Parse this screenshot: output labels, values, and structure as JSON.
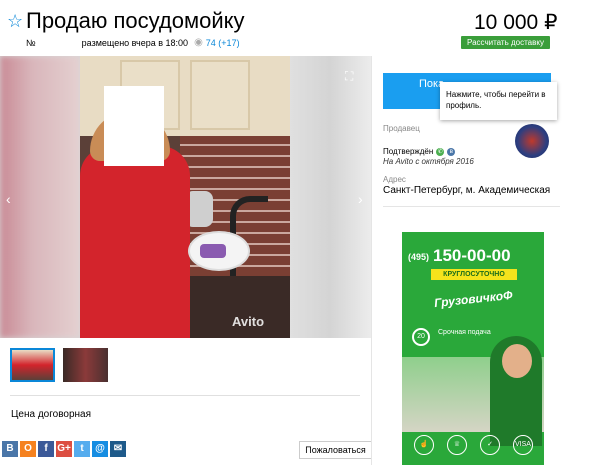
{
  "listing": {
    "title": "Продаю посудомойку",
    "price": "10 000 ₽",
    "number_label": "№",
    "posted": "размещено вчера в 18:00",
    "views": "74 (+17)",
    "delivery_btn": "Рассчитать доставку",
    "negotiable": "Цена договорная"
  },
  "gallery": {
    "watermark": "Avito",
    "prev": "‹",
    "next": "›"
  },
  "seller": {
    "show_btn": "Пока...",
    "tooltip": "Нажмите, чтобы перейти в профиль.",
    "label": "Продавец",
    "confirmed": "Подтверждён",
    "since": "На Avito с октября 2016",
    "address_label": "Адрес",
    "address": "Санкт-Петербург, м. Академическая"
  },
  "share": {
    "buttons": [
      "В",
      "О",
      "f",
      "G+",
      "t",
      "@",
      "✉"
    ],
    "colors": [
      "#4a76a8",
      "#f58220",
      "#3b5998",
      "#dc4e41",
      "#55acee",
      "#168de2",
      "#1e5a8a"
    ],
    "complain": "Пожаловаться"
  },
  "ad": {
    "code": "(495)",
    "phone": "150-00-00",
    "badge": "КРУГЛОСУТОЧНО",
    "brand": "ГрузовичкоФ",
    "minutes": "20",
    "urgent": "Срочная подача",
    "icons": [
      "",
      "",
      "",
      "VISA"
    ]
  }
}
